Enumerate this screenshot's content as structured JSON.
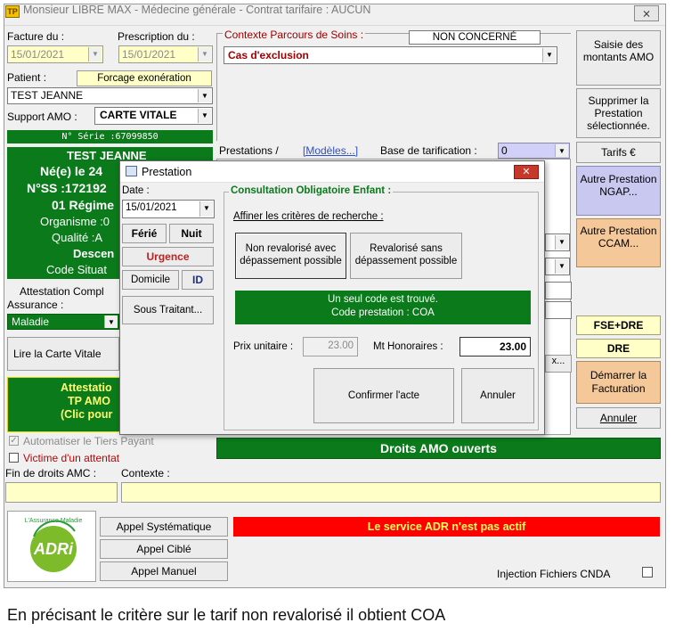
{
  "window": {
    "title": "Monsieur LIBRE MAX - Médecine générale - Contrat tarifaire : AUCUN",
    "close": "⨯"
  },
  "left": {
    "facture_label": "Facture du :",
    "facture_date": "15/01/2021",
    "prescription_label": "Prescription du :",
    "prescription_date": "15/01/2021",
    "patient_label": "Patient :",
    "forcage_btn": "Forcage exonération",
    "patient_value": "TEST JEANNE",
    "support_label": "Support AMO :",
    "support_value": "CARTE VITALE",
    "serie": "N° Série :67099850",
    "card_lines": [
      "TEST JEANNE",
      "Né(e) le 24",
      "N°SS :172192",
      "01 Régime",
      "Organisme :0",
      "Qualité :A",
      "Descen",
      "Code Situat"
    ],
    "attestation": "Attestation Compl",
    "assurance_label": "Assurance :",
    "assurance_value": "Maladie",
    "lire_carte": "Lire la Carte Vitale",
    "attestation_box": [
      "Attestatio",
      "TP AMO",
      "(Clic pour"
    ],
    "automatiser": "Automatiser le Tiers Payant",
    "victime": "Victime d'un attentat",
    "fin_droits": "Fin de droits AMC :",
    "contexte_label": "Contexte :"
  },
  "center": {
    "parcours_label": "Contexte Parcours de Soins :",
    "parcours_value": "NON CONCERNÉ",
    "exclusion_value": "Cas d'exclusion",
    "prestations_label": "Prestations /",
    "modeles_link": "[Modèles...]",
    "base_label": "Base de tarification :",
    "base_value": "0",
    "ellipsis_btn": "x...",
    "droits_amo": "Droits AMO ouverts"
  },
  "right": {
    "saisie": "Saisie des montants AMO",
    "supprimer": "Supprimer la Prestation sélectionnée.",
    "tarifs": "Tarifs €",
    "autre_ngap": "Autre Prestation NGAP...",
    "autre_ccam": "Autre Prestation CCAM...",
    "fse_dre": "FSE+DRE",
    "dre": "DRE",
    "demarrer": "Démarrer la Facturation",
    "annuler": "Annuler"
  },
  "bottom": {
    "appel_systematique": "Appel Systématique",
    "appel_cible": "Appel Ciblé",
    "appel_manuel": "Appel Manuel",
    "adr_status": "Le service ADR n'est pas actif",
    "injection": "Injection Fichiers CNDA",
    "logo_text": "ADRi",
    "logo_arc": "L'Assurance Maladie"
  },
  "dialog": {
    "title": "Prestation",
    "date_label": "Date :",
    "date_value": "15/01/2021",
    "ferie": "Férié",
    "nuit": "Nuit",
    "urgence": "Urgence",
    "domicile": "Domicile",
    "id": "ID",
    "sous_traitant": "Sous Traitant...",
    "group_title": "Consultation Obligatoire Enfant :",
    "affiner": "Affiner les critères de recherche :",
    "non_revalorise": "Non revalorisé avec dépassement possible",
    "revalorise": "Revalorisé sans dépassement possible",
    "result_line1": "Un seul code est trouvé.",
    "result_line2": "Code prestation : COA",
    "prix_label": "Prix unitaire :",
    "prix_value": "23.00",
    "mt_label": "Mt Honoraires :",
    "mt_value": "23.00",
    "confirmer": "Confirmer l'acte",
    "annuler": "Annuler"
  },
  "caption": "En précisant le critère sur le tarif non revalorisé il obtient COA",
  "colors": {
    "green": "#0a7a1a",
    "yellow": "#ffffc8",
    "blue_btn": "#c8c8f0",
    "orange_btn": "#f5c89a",
    "red_bar": "#ff0000"
  }
}
